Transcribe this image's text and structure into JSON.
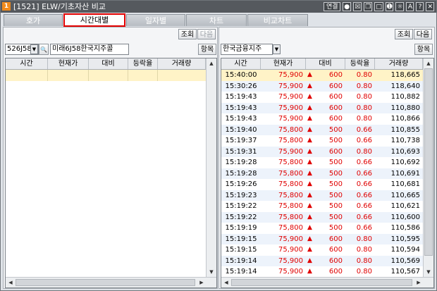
{
  "window": {
    "number": "1",
    "title": "[1521] ELW/기초자산 비교",
    "title_icons": [
      "연결",
      "mic-icon",
      "close-box-icon",
      "copy-icon",
      "window-icon",
      "pin-icon",
      "settings-icon",
      "font-icon",
      "help-icon",
      "close-icon"
    ]
  },
  "tabs": [
    {
      "label": "호가"
    },
    {
      "label": "시간대별"
    },
    {
      "label": "일자별"
    },
    {
      "label": "차트"
    },
    {
      "label": "비교차트"
    }
  ],
  "left": {
    "query_label": "조회",
    "next_label": "다음",
    "code_value": "526J58",
    "name_value": "미래6J58한국지주콜",
    "item_label": "항목",
    "columns": [
      "시간",
      "현재가",
      "대비",
      "등락율",
      "거래량"
    ]
  },
  "right": {
    "query_label": "조회",
    "next_label": "다음",
    "stock_value": "한국금융지주",
    "item_label": "항목",
    "columns": [
      "시간",
      "현재가",
      "대비",
      "등락율",
      "거래량"
    ],
    "rows": [
      {
        "time": "15:40:00",
        "price": "75,900",
        "change": "600",
        "rate": "0.80",
        "volume": "118,665"
      },
      {
        "time": "15:30:26",
        "price": "75,900",
        "change": "600",
        "rate": "0.80",
        "volume": "118,640"
      },
      {
        "time": "15:19:43",
        "price": "75,900",
        "change": "600",
        "rate": "0.80",
        "volume": "110,882"
      },
      {
        "time": "15:19:43",
        "price": "75,900",
        "change": "600",
        "rate": "0.80",
        "volume": "110,880"
      },
      {
        "time": "15:19:43",
        "price": "75,900",
        "change": "600",
        "rate": "0.80",
        "volume": "110,866"
      },
      {
        "time": "15:19:40",
        "price": "75,800",
        "change": "500",
        "rate": "0.66",
        "volume": "110,855"
      },
      {
        "time": "15:19:37",
        "price": "75,800",
        "change": "500",
        "rate": "0.66",
        "volume": "110,738"
      },
      {
        "time": "15:19:31",
        "price": "75,900",
        "change": "600",
        "rate": "0.80",
        "volume": "110,693"
      },
      {
        "time": "15:19:28",
        "price": "75,800",
        "change": "500",
        "rate": "0.66",
        "volume": "110,692"
      },
      {
        "time": "15:19:28",
        "price": "75,800",
        "change": "500",
        "rate": "0.66",
        "volume": "110,691"
      },
      {
        "time": "15:19:26",
        "price": "75,800",
        "change": "500",
        "rate": "0.66",
        "volume": "110,681"
      },
      {
        "time": "15:19:23",
        "price": "75,800",
        "change": "500",
        "rate": "0.66",
        "volume": "110,665"
      },
      {
        "time": "15:19:22",
        "price": "75,800",
        "change": "500",
        "rate": "0.66",
        "volume": "110,621"
      },
      {
        "time": "15:19:22",
        "price": "75,800",
        "change": "500",
        "rate": "0.66",
        "volume": "110,600"
      },
      {
        "time": "15:19:19",
        "price": "75,800",
        "change": "500",
        "rate": "0.66",
        "volume": "110,586"
      },
      {
        "time": "15:19:15",
        "price": "75,900",
        "change": "600",
        "rate": "0.80",
        "volume": "110,595"
      },
      {
        "time": "15:19:15",
        "price": "75,900",
        "change": "600",
        "rate": "0.80",
        "volume": "110,594"
      },
      {
        "time": "15:19:14",
        "price": "75,900",
        "change": "600",
        "rate": "0.80",
        "volume": "110,569"
      },
      {
        "time": "15:19:14",
        "price": "75,900",
        "change": "600",
        "rate": "0.80",
        "volume": "110,567"
      }
    ]
  },
  "symbols": {
    "up": "▲",
    "dropdown": "▼",
    "search": "🔍",
    "scroll_up": "▲",
    "scroll_down": "▼",
    "scroll_left": "◀",
    "scroll_right": "▶"
  },
  "colors": {
    "up": "#e00000",
    "active_tab_border": "#e30000",
    "selected_row": "#fff3c7",
    "alt_row": "#edf3fb"
  }
}
